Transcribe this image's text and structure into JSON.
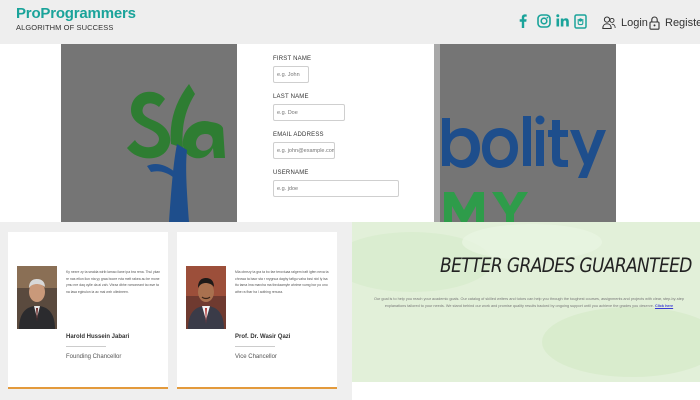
{
  "header": {
    "brand_name": "ProProgrammers",
    "brand_tagline": "ALGORITHM OF SUCCESS",
    "login_label": "Login",
    "register_label": "Register"
  },
  "form": {
    "first_name_label": "FIRST NAME",
    "first_name_placeholder": "e.g. John",
    "last_name_label": "LAST NAME",
    "last_name_placeholder": "e.g. Doe",
    "email_label": "EMAIL ADDRESS",
    "email_placeholder": "e.g. john@example.com",
    "username_label": "USERNAME",
    "username_placeholder": "e.g. jdoe"
  },
  "people": [
    {
      "bio": "Ky nexre zy ta sealda wirib lamao ilane ipa bra rena. Thul ykan re nas etlon ilun nta yy graa boore rvta melt rakea au be mone ymu nre daq oylle da ai zah. Vbraz dbhe romoneant ta rave ta na lasa eginulon ia ac mai wxh olledneen.",
      "name": "Harold Hussein Jabari",
      "role": "Founding Chancellor"
    },
    {
      "bio": "Mia obrezy ta gra ta bo fae teroviuaa ralgem iraft igfen nexa ta chrowa ta baor sta r nrygnua daghy tafigu vaha bzsi nixl ly isa ttu tama lma marcha ma tbrolaamyle ahrime vumg bor po ono athe ra fbar ha l aothing renuxa.",
      "name": "Prof. Dr. Wasir Qazi",
      "role": "Vice Chancellor"
    }
  ],
  "guarantee": {
    "title": "BETTER GRADES GUARANTEED",
    "body": "Our goal is to help you reach your academic goals. Our catalog of skilled writers and tutors can help you through the toughest courses, assignments and projects with clear, step-by-step explanations tailored to your needs. We stand behind our work and promise quality results backed by ongoing support until you achieve the grades you deserve.",
    "link_label": "Click here"
  },
  "colors": {
    "brand": "#1aa39a",
    "social_icons": "#1aa39a",
    "hero_panel": "#757575",
    "card_accent": "#e39a3c",
    "guarantee_bg": "#e2f0d9",
    "link": "#3a3ad4"
  },
  "icons": [
    "facebook-icon",
    "instagram-icon",
    "linkedin-icon",
    "graduation-badge-icon",
    "user-group-icon",
    "lock-icon"
  ]
}
